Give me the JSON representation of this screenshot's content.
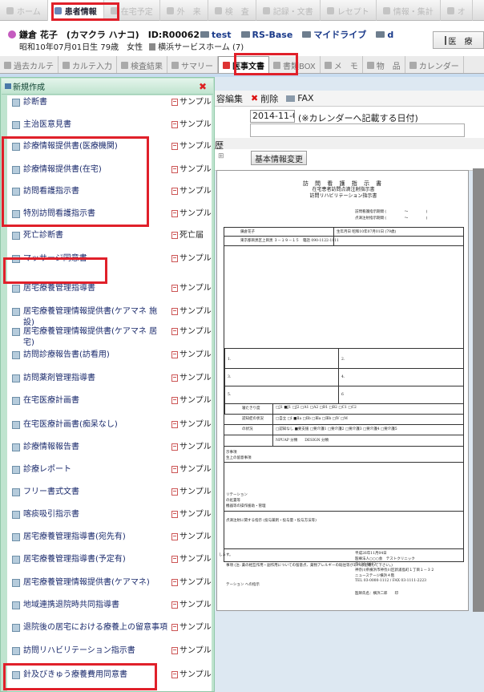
{
  "nav": {
    "items": [
      "ホーム",
      "患者情報",
      "在宅予定",
      "外　来",
      "検　査",
      "記録・文書",
      "レセプト",
      "情報・集計",
      "オ"
    ],
    "active_index": 1
  },
  "patient": {
    "name_line": "鎌倉 花子　(カマクラ ハナコ)　ID:R00062",
    "links": [
      "test",
      "RS-Base",
      "マイドライブ",
      "d"
    ],
    "sub": "昭和10年07月01日生 79歳　女性",
    "facility": "横浜サービスホーム (7)",
    "right_button": "医　療"
  },
  "tabs": {
    "items": [
      "過去カルテ",
      "カルテ入力",
      "検査結果",
      "サマリー",
      "医事文書",
      "書類BOX",
      "メ　モ",
      "物　品",
      "カレンダー"
    ],
    "active_index": 4
  },
  "toolbar": {
    "items": [
      "容編集",
      "削除",
      "FAX"
    ]
  },
  "date_panel": {
    "date_value": "2014-11-0",
    "date_note": "(※カレンダーへ記載する日付)",
    "history_label": "歴",
    "grid_label": "⊞",
    "basic_button": "基本情報変更"
  },
  "document": {
    "title1": "訪 問 看 護 指 示 書",
    "title2": "在宅患者訪問点滴注射指示書",
    "title3": "訪問リハビリテーション指示書",
    "period1": "訪問看護指示期間 (　　　　　～　　　　　)",
    "period2": "点滴注射指示期間 (　　　　　～　　　　　)",
    "patient_name": "鎌倉花子",
    "birth": "生年月日 昭和10年07月01日 (79歳)",
    "address": "東京都目黒区上目黒 ３－１９－１５　電話 090-1122-1111",
    "nums": [
      "1.",
      "2.",
      "3.",
      "4.",
      "5.",
      "6"
    ],
    "rows": [
      "寝たきり度",
      "認知症の状況",
      "の状況"
    ],
    "rank1": "□J1 ■J1 □J2 □A1 □A2 □B1 □B2 □C1 □C2",
    "rank2": "□自立 □Ⅰ ■Ⅱa □Ⅱb □Ⅲa □Ⅲb □Ⅳ □M",
    "rank3": "□認知なし ■要支援 □要介護1 □要介護2 □要介護3 □要介護4 □要介護5",
    "npuap": "NPUAP 分類　　DESIGN 分類",
    "s1": "示事項",
    "s2": "生上の留意事項",
    "s3": "リテーション",
    "s4": "の処置等",
    "s5": "機器等の操作援助・管理",
    "s6": "点滴注射に関する指示 (投与薬剤・投与量・投与方法等)",
    "s7": "事項 (注: 薬の相互作用・副作用についての留意点、薬物アレルギーの既往等があれば記載して下さい。)",
    "s8": "テーション への指示",
    "s9": "します。",
    "f1": "平成26年11月04日",
    "f2": "医療法人○○○会　テストクリニック",
    "f3": "〒100-0002",
    "f4": "神奈川県横浜市神奈川区新浦島町１丁目１－３２",
    "f5": "ニューステージ横浜４階",
    "f6": "TEL 03-0000-1112 / FAX 03-1111-2223",
    "f7": "医師氏名：横浜二郎　　印"
  },
  "panel": {
    "title": "新規作成",
    "close": "✖",
    "sample": "サンプル",
    "sample2": "死亡届",
    "items": [
      "診断書",
      "主治医意見書",
      "診療情報提供書(医療機関)",
      "診療情報提供書(在宅)",
      "訪問看護指示書",
      "特別訪問看護指示書",
      "死亡診断書",
      "マッサージ同意書",
      "居宅療養管理指導書",
      "居宅療養管理情報提供書(ケアマネ 施設)",
      "居宅療養管理情報提供書(ケアマネ 居宅)",
      "訪問診療報告書(訪看用)",
      "訪問薬剤管理指導書",
      "在宅医療計画書",
      "在宅医療計画書(痴呆なし)",
      "診療情報報告書",
      "診療レポート",
      "フリー書式文書",
      "喀痰吸引指示書",
      "居宅療養管理指導書(宛先有)",
      "居宅療養管理指導書(予定有)",
      "居宅療養管理情報提供書(ケアマネ)",
      "地域連携退院時共同指導書",
      "退院後の居宅における療養上の留意事項",
      "訪問リハビリテーション指示書",
      "針及びきゅう療養費用同意書"
    ]
  }
}
